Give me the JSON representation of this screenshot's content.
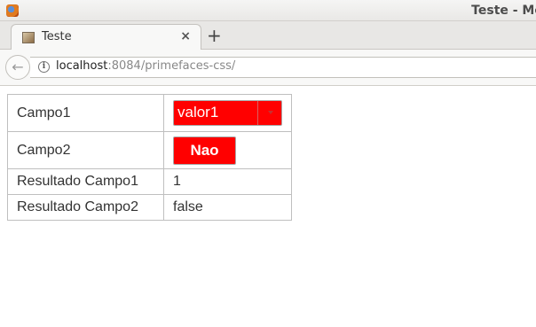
{
  "window": {
    "title": "Teste - Mo",
    "app_icon": "firefox-icon"
  },
  "tabs": [
    {
      "label": "Teste",
      "favicon": "page-icon",
      "close_glyph": "×",
      "active": true
    }
  ],
  "new_tab_glyph": "+",
  "navbar": {
    "back_glyph": "←",
    "info_glyph": "i",
    "url_host": "localhost",
    "url_rest": ":8084/primefaces-css/"
  },
  "form": {
    "rows": [
      {
        "label": "Campo1",
        "control": "dropdown",
        "value": "valor1"
      },
      {
        "label": "Campo2",
        "control": "toggle-button",
        "value": "Nao"
      },
      {
        "label": "Resultado Campo1",
        "value": "1"
      },
      {
        "label": "Resultado Campo2",
        "value": "false"
      }
    ]
  },
  "colors": {
    "control_background": "#ff0000",
    "control_text": "#ffffff"
  }
}
